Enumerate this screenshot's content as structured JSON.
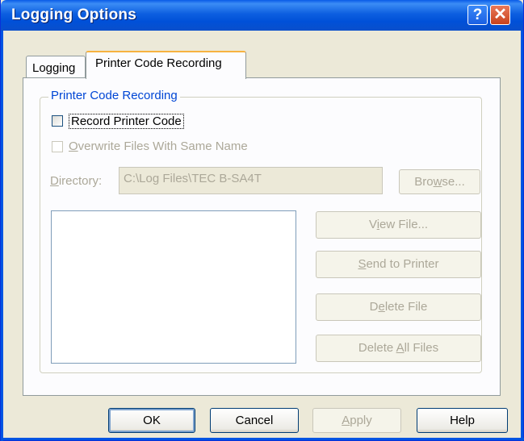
{
  "window": {
    "title": "Logging Options",
    "help_glyph": "?",
    "close_glyph": "✕"
  },
  "tabs": [
    {
      "label": "Logging",
      "selected": false
    },
    {
      "label": "Printer Code Recording",
      "selected": true
    }
  ],
  "group": {
    "title": "Printer Code Recording"
  },
  "record_printer_code": {
    "label": "Record Printer Code",
    "checked": false,
    "enabled": true
  },
  "overwrite_files": {
    "label_pre": "",
    "label_accel": "O",
    "label_post": "verwrite Files With Same Name",
    "checked": false,
    "enabled": false
  },
  "directory": {
    "label_accel": "D",
    "label_post": "irectory:",
    "value": "C:\\Log Files\\TEC B-SA4T"
  },
  "buttons": {
    "browse": {
      "pre": "Bro",
      "accel": "w",
      "post": "se..."
    },
    "view_file": {
      "pre": "V",
      "accel": "i",
      "post": "ew File..."
    },
    "send_to_printer": {
      "pre": "",
      "accel": "S",
      "post": "end to Printer"
    },
    "delete_file": {
      "pre": "D",
      "accel": "e",
      "post": "lete File"
    },
    "delete_all": {
      "pre": "Delete ",
      "accel": "A",
      "post": "ll Files"
    }
  },
  "dialog_buttons": {
    "ok": "OK",
    "cancel": "Cancel",
    "apply_accel": "A",
    "apply_post": "pply",
    "help": "Help"
  },
  "colors": {
    "title_bar": "#0054e3",
    "dialog_bg": "#ece9d8",
    "group_title": "#0046d5",
    "disabled_text": "#aca899",
    "tab_highlight": "#f7b240"
  }
}
